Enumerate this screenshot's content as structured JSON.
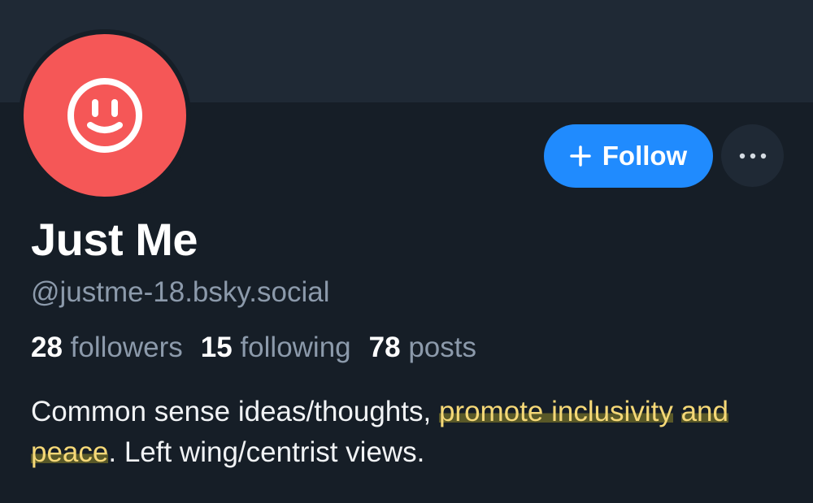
{
  "profile": {
    "display_name": "Just Me",
    "handle": "@justme-18.bsky.social",
    "stats": [
      {
        "count": "28",
        "label": "followers"
      },
      {
        "count": "15",
        "label": "following"
      },
      {
        "count": "78",
        "label": "posts"
      }
    ],
    "bio": {
      "part1": "Common sense ideas/thoughts, ",
      "highlight1": "promote inclusivity",
      "highlight2": "and peace",
      "part2": ". Left wing/centrist views."
    }
  },
  "actions": {
    "follow_label": "Follow",
    "follow_icon": "plus-icon",
    "more_icon": "ellipsis-icon"
  },
  "avatar": {
    "icon": "smiley-face-icon"
  },
  "colors": {
    "background": "#161e27",
    "banner": "#1f2935",
    "avatar": "#f55757",
    "accent": "#208bfe",
    "muted_text": "#8c9aab",
    "highlight_text": "#f5d877"
  }
}
